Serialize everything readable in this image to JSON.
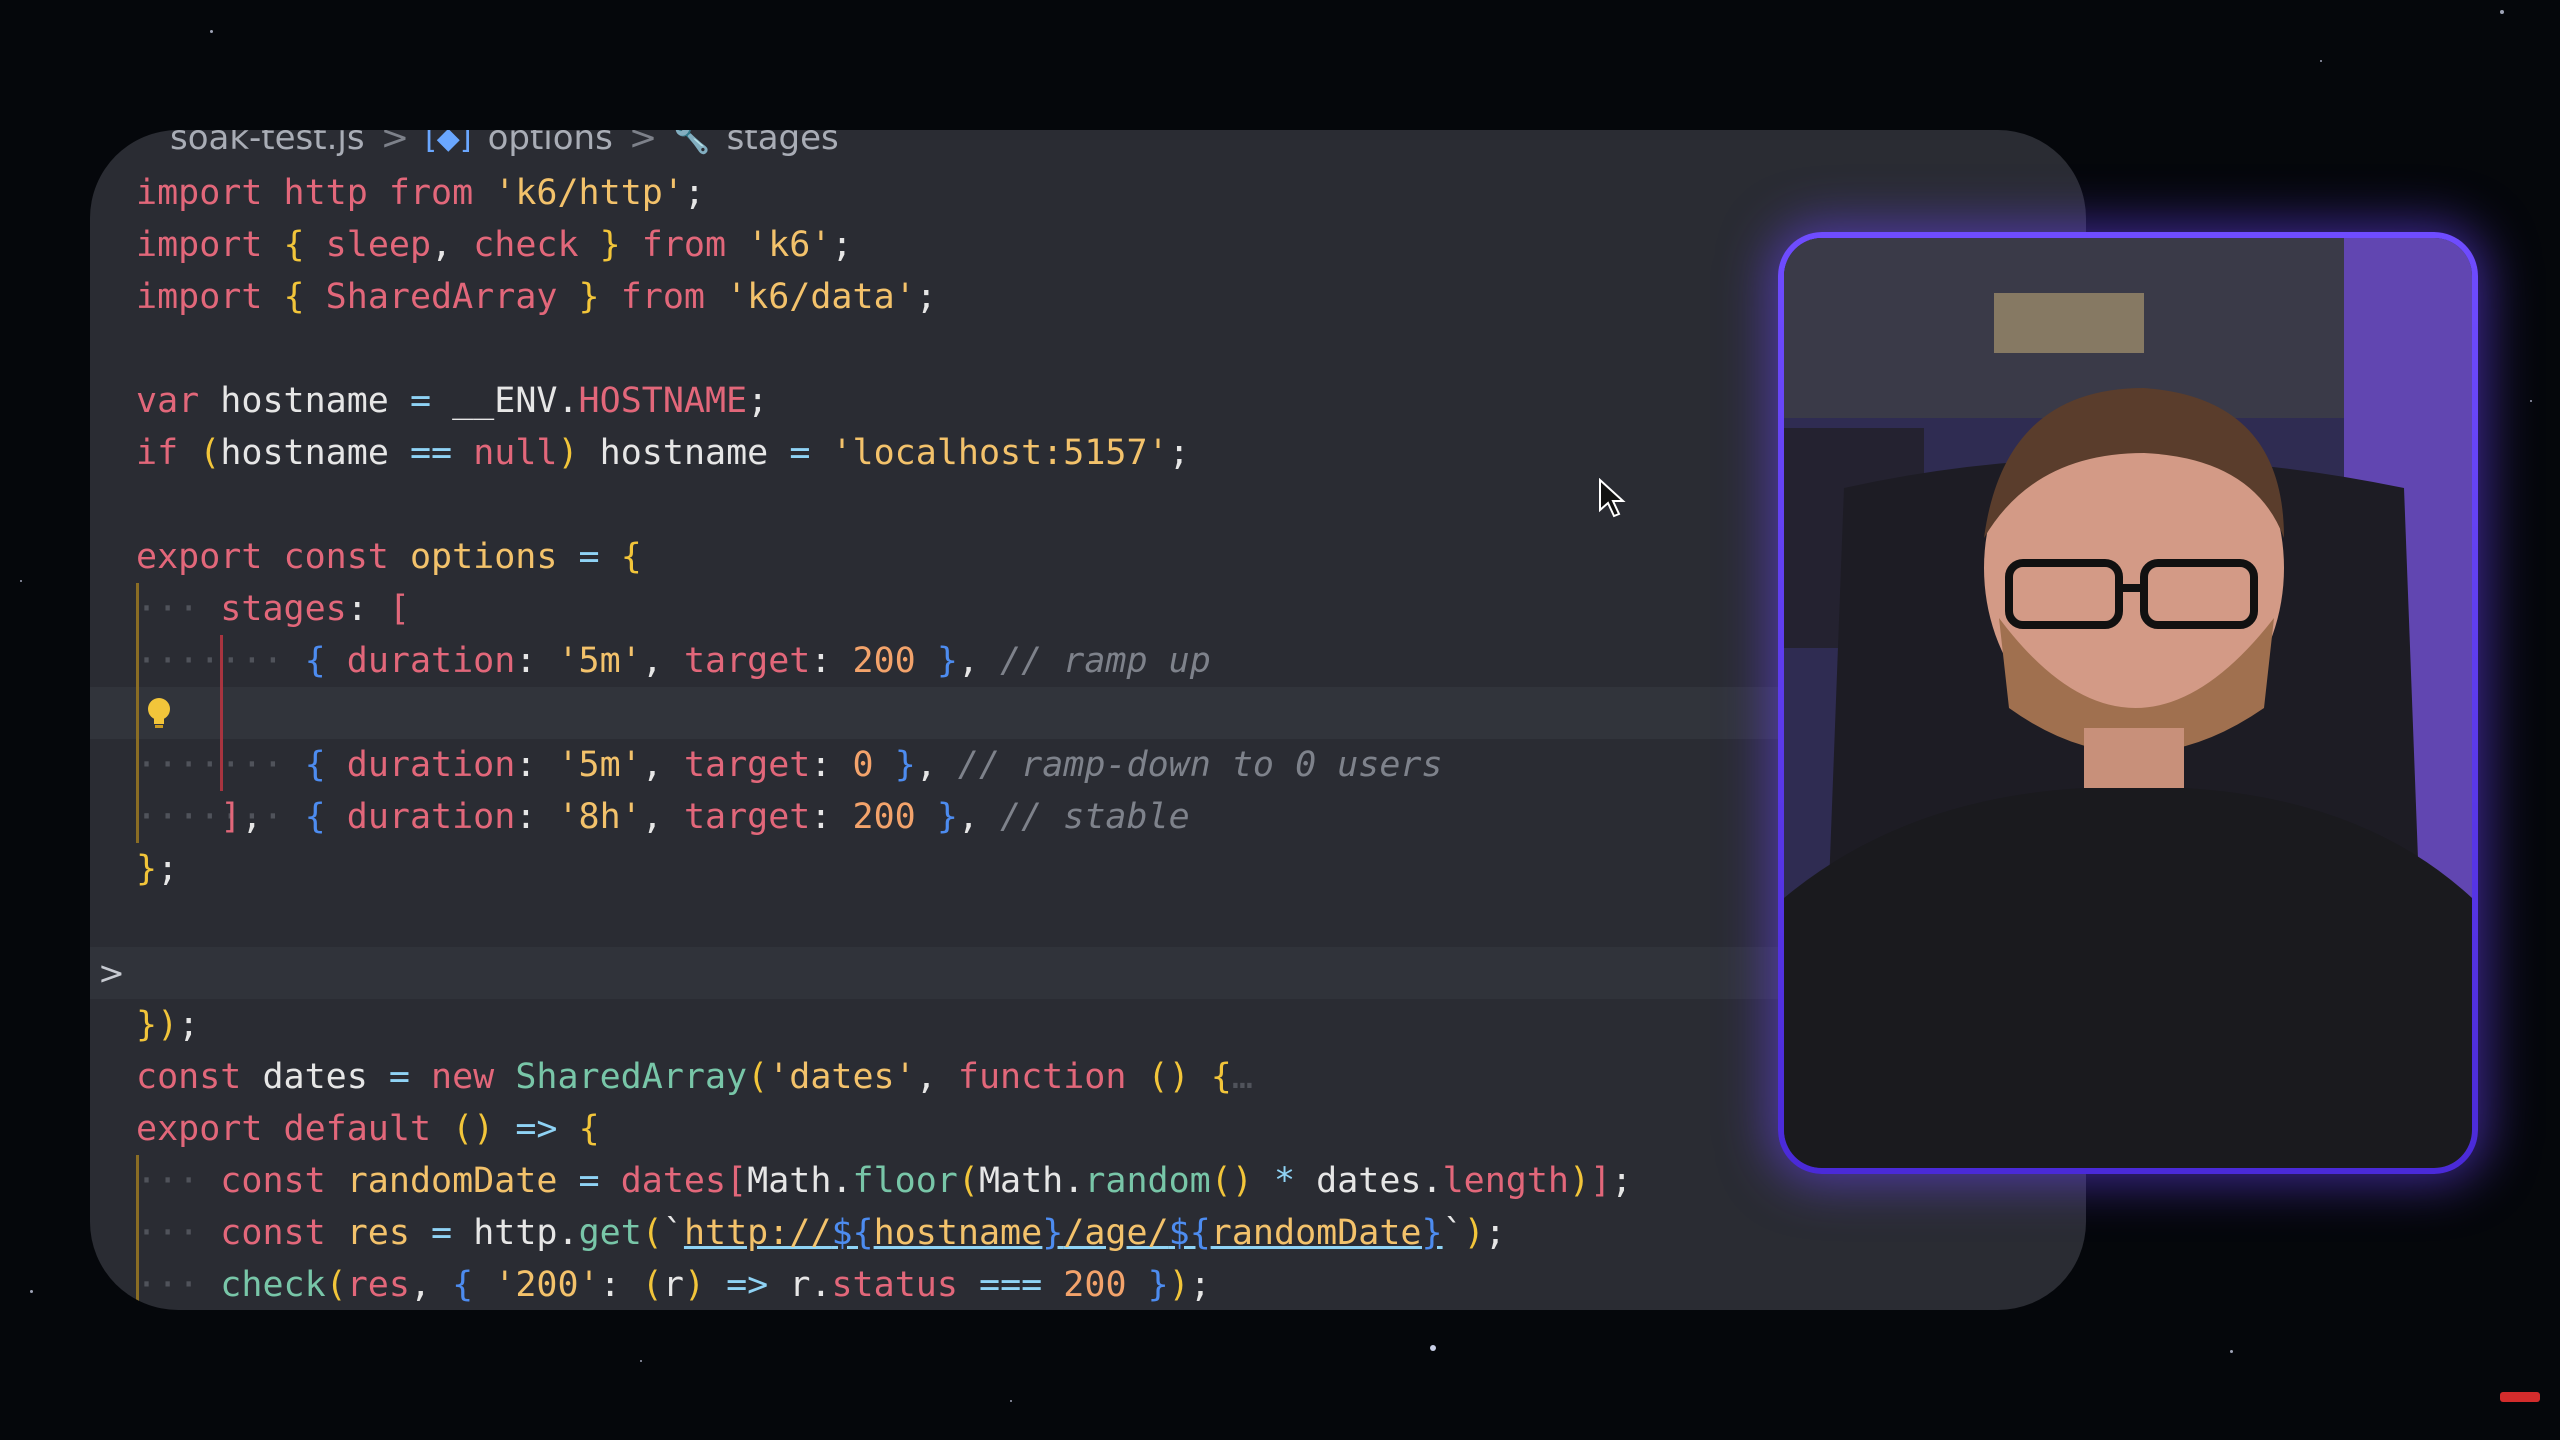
{
  "breadcrumb": {
    "file": "soak-test.js",
    "separator": ">",
    "items": [
      {
        "label": "options",
        "icon": "variable-icon"
      },
      {
        "label": "stages",
        "icon": "wrench-icon"
      }
    ]
  },
  "code": {
    "lines": [
      [
        "import http from 'k6/http';"
      ],
      [
        "import { sleep, check } from 'k6';"
      ],
      [
        "import { SharedArray } from 'k6/data';"
      ],
      [
        ""
      ],
      [
        "var hostname = __ENV.HOSTNAME;"
      ],
      [
        "if (hostname == null) hostname = 'localhost:5157';"
      ],
      [
        ""
      ],
      [
        "export const options = {"
      ],
      [
        "  stages: ["
      ],
      [
        "    { duration: '5m', target: 200 }, // ramp up"
      ],
      [
        "    { duration: '8h', target: 200 }, // stable"
      ],
      [
        "    { duration: '5m', target: 0 }, // ramp-down to 0 users"
      ],
      [
        "  ],"
      ],
      [
        "};"
      ],
      [
        ""
      ],
      [
        "const dates = new SharedArray('dates', function () {…"
      ],
      [
        "});"
      ],
      [
        ""
      ],
      [
        "export default () => {"
      ],
      [
        "  const randomDate = dates[Math.floor(Math.random() * dates.length)];"
      ],
      [
        "  const res = http.get(`http://${hostname}/age/${randomDate}`);"
      ],
      [
        "  check(res, { '200': (r) => r.status === 200 });"
      ]
    ]
  },
  "tokens": {
    "import": "import",
    "from": "from",
    "http": "http",
    "k6http": "'k6/http'",
    "k6": "'k6'",
    "k6data": "'k6/data'",
    "sleep": "sleep",
    "check": "check",
    "SharedArray": "SharedArray",
    "var": "var",
    "hostname": "hostname",
    "env": "__ENV",
    "HOSTNAME": "HOSTNAME",
    "if": "if",
    "null": "null",
    "localhost": "'localhost:5157'",
    "export": "export",
    "const": "const",
    "options": "options",
    "stages": "stages",
    "duration": "duration",
    "target": "target",
    "d5m": "'5m'",
    "d8h": "'8h'",
    "n200": "200",
    "n0": "0",
    "c1": "// ramp up",
    "c2": "// stable",
    "c3": "// ramp-down to 0 users",
    "dates": "dates",
    "new": "new",
    "datesStr": "'dates'",
    "function": "function",
    "default": "default",
    "randomDate": "randomDate",
    "Math": "Math",
    "floor": "floor",
    "random": "random",
    "length": "length",
    "res": "res",
    "get": "get",
    "urlStart": "http://",
    "age": "/age/",
    "s200": "'200'",
    "r": "r",
    "status": "status"
  },
  "webcam": {
    "label": "presenter-webcam"
  },
  "colors": {
    "accent": "#6f4cff",
    "editor_bg": "#2a2c33",
    "page_bg": "#05070b"
  }
}
